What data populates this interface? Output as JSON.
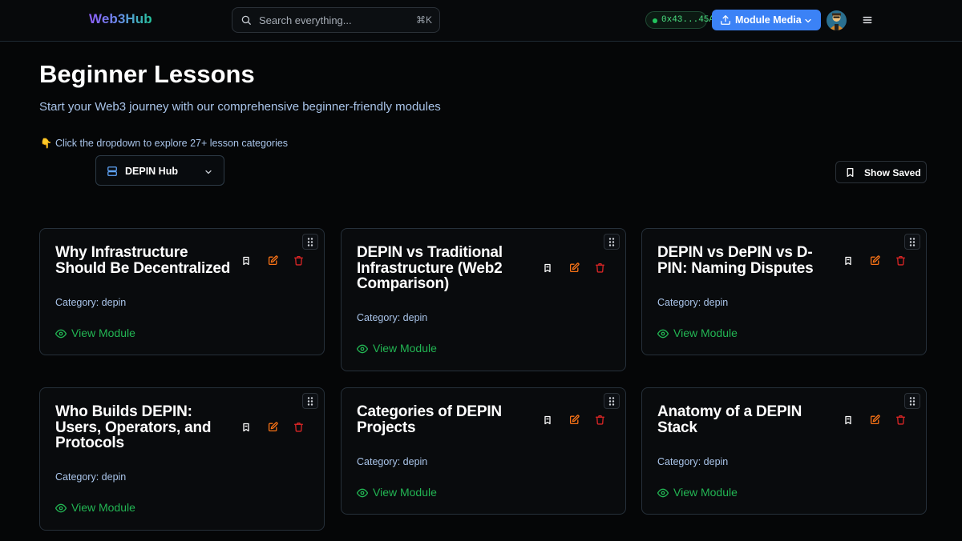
{
  "header": {
    "logo": "Web3Hub",
    "search_placeholder": "Search everything...",
    "search_shortcut": "⌘K",
    "wallet_address": "0x43...45A",
    "media_button": "Module Media",
    "icons": [
      "search-icon",
      "upload-icon",
      "chevron-down-icon",
      "avatar",
      "menu-icon"
    ]
  },
  "page": {
    "title": "Beginner Lessons",
    "subtitle": "Start your Web3 journey with our comprehensive beginner-friendly modules",
    "hint_emoji": "👇",
    "hint": "Click the dropdown to explore 27+ lesson categories",
    "category_selected": "DEPIN Hub",
    "show_saved": "Show Saved"
  },
  "cards": [
    {
      "title": "Why Infrastructure Should Be Decentralized",
      "category": "Category: depin",
      "action": "View Module"
    },
    {
      "title": "DEPIN vs Traditional Infrastructure (Web2 Comparison)",
      "category": "Category: depin",
      "action": "View Module"
    },
    {
      "title": "DEPIN vs DePIN vs D-PIN: Naming Disputes",
      "category": "Category: depin",
      "action": "View Module"
    },
    {
      "title": "Who Builds DEPIN: Users, Operators, and Protocols",
      "category": "Category: depin",
      "action": "View Module"
    },
    {
      "title": "Categories of DEPIN Projects",
      "category": "Category: depin",
      "action": "View Module"
    },
    {
      "title": "Anatomy of a DEPIN Stack",
      "category": "Category: depin",
      "action": "View Module"
    }
  ],
  "colors": {
    "background": "#050607",
    "accent_blue": "#3b82f6",
    "view_green": "#22b553",
    "edit_orange": "#f97316",
    "delete_red": "#dc2626",
    "muted_blue_text": "#a9c4e9"
  }
}
